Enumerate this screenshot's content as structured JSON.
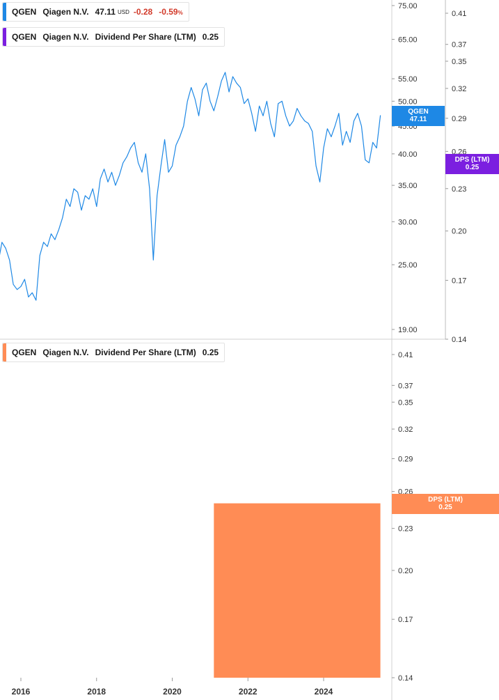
{
  "legends": {
    "price": {
      "ticker": "QGEN",
      "name": "Qiagen N.V.",
      "price": "47.11",
      "currency": "USD",
      "change": "-0.28",
      "change_pct": "-0.59",
      "pct_sign": "%",
      "color": "#1e88e5"
    },
    "dps_top": {
      "ticker": "QGEN",
      "name": "Qiagen N.V.",
      "metric": "Dividend Per Share (LTM)",
      "value": "0.25",
      "color": "#7b1fe0"
    },
    "dps_bottom": {
      "ticker": "QGEN",
      "name": "Qiagen N.V.",
      "metric": "Dividend Per Share (LTM)",
      "value": "0.25",
      "color": "#ff8c55"
    }
  },
  "tags": {
    "price": {
      "ticker": "QGEN",
      "value": "47.11",
      "color": "#1e88e5"
    },
    "dps_top": {
      "label": "DPS (LTM)",
      "value": "0.25",
      "color": "#7b1fe0"
    },
    "dps_bottom": {
      "label": "DPS (LTM)",
      "value": "0.25",
      "color": "#ff8c55"
    }
  },
  "chart_data": [
    {
      "type": "line",
      "scale": "log",
      "series": [
        {
          "name": "QGEN",
          "color": "#1e88e5",
          "x": [
            2015.0,
            2015.1,
            2015.2,
            2015.3,
            2015.4,
            2015.5,
            2015.6,
            2015.7,
            2015.8,
            2015.9,
            2016.0,
            2016.1,
            2016.2,
            2016.3,
            2016.4,
            2016.5,
            2016.6,
            2016.7,
            2016.8,
            2016.9,
            2017.0,
            2017.1,
            2017.2,
            2017.3,
            2017.4,
            2017.5,
            2017.6,
            2017.7,
            2017.8,
            2017.9,
            2018.0,
            2018.1,
            2018.2,
            2018.3,
            2018.4,
            2018.5,
            2018.6,
            2018.7,
            2018.8,
            2018.9,
            2019.0,
            2019.1,
            2019.2,
            2019.3,
            2019.4,
            2019.5,
            2019.6,
            2019.7,
            2019.8,
            2019.9,
            2020.0,
            2020.1,
            2020.2,
            2020.3,
            2020.4,
            2020.5,
            2020.6,
            2020.7,
            2020.8,
            2020.9,
            2021.0,
            2021.1,
            2021.2,
            2021.3,
            2021.4,
            2021.5,
            2021.6,
            2021.7,
            2021.8,
            2021.9,
            2022.0,
            2022.1,
            2022.2,
            2022.3,
            2022.4,
            2022.5,
            2022.6,
            2022.7,
            2022.8,
            2022.9,
            2023.0,
            2023.1,
            2023.2,
            2023.3,
            2023.4,
            2023.5,
            2023.6,
            2023.7,
            2023.8,
            2023.9,
            2024.0,
            2024.1,
            2024.2,
            2024.3,
            2024.4,
            2024.5,
            2024.6,
            2024.7,
            2024.8,
            2024.9,
            2025.0,
            2025.1,
            2025.2,
            2025.3,
            2025.4,
            2025.5
          ],
          "values": [
            25.0,
            27.0,
            26.5,
            24.5,
            25.2,
            27.5,
            26.8,
            25.5,
            23.0,
            22.5,
            22.8,
            23.5,
            21.8,
            22.2,
            21.5,
            26.0,
            27.5,
            27.0,
            28.5,
            27.8,
            29.0,
            30.5,
            33.0,
            32.0,
            34.5,
            34.0,
            31.5,
            33.5,
            33.0,
            34.5,
            32.0,
            36.0,
            37.5,
            35.5,
            37.0,
            35.0,
            36.5,
            38.5,
            39.5,
            41.0,
            42.0,
            38.5,
            37.0,
            40.0,
            34.5,
            25.5,
            33.5,
            38.0,
            42.5,
            37.0,
            38.0,
            41.5,
            43.0,
            45.0,
            50.0,
            53.0,
            50.5,
            47.0,
            52.5,
            54.0,
            50.0,
            48.0,
            51.0,
            54.5,
            56.5,
            52.0,
            55.5,
            54.0,
            53.0,
            49.5,
            50.5,
            47.5,
            44.0,
            49.0,
            47.0,
            50.0,
            45.5,
            43.0,
            49.5,
            50.0,
            47.0,
            45.0,
            46.0,
            48.5,
            47.0,
            46.0,
            45.5,
            44.0,
            38.0,
            35.5,
            41.0,
            44.5,
            43.0,
            45.0,
            47.5,
            41.5,
            44.0,
            42.0,
            46.0,
            47.5,
            45.0,
            39.0,
            38.5,
            42.0,
            41.0,
            47.11
          ]
        }
      ],
      "y_ticks": [
        "75.00",
        "65.00",
        "55.00",
        "50.00",
        "45.00",
        "40.00",
        "35.00",
        "30.00",
        "25.00",
        "19.00"
      ],
      "ylim": [
        19,
        75
      ],
      "y2_ticks": [
        "0.41",
        "0.37",
        "0.35",
        "0.32",
        "0.29",
        "0.26",
        "0.23",
        "0.20",
        "0.17",
        "0.14"
      ],
      "y2lim": [
        0.14,
        0.41
      ]
    },
    {
      "type": "area",
      "scale": "log",
      "series": [
        {
          "name": "DPS (LTM)",
          "color": "#ff8c55",
          "x": [
            2021.1,
            2025.5
          ],
          "values": [
            0.25,
            0.25
          ]
        }
      ],
      "y_ticks": [
        "0.41",
        "0.37",
        "0.35",
        "0.32",
        "0.29",
        "0.26",
        "0.23",
        "0.20",
        "0.17",
        "0.14"
      ],
      "ylim": [
        0.14,
        0.41
      ]
    }
  ],
  "x_ticks": [
    "2016",
    "2018",
    "2020",
    "2022",
    "2024"
  ]
}
